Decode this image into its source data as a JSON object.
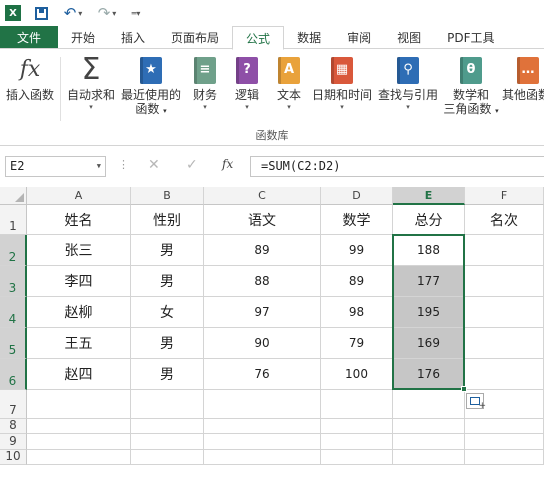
{
  "quick_access": {
    "app_icon": "excel-logo",
    "app_letter": "X",
    "save_icon": "save-icon",
    "undo_icon": "undo-icon",
    "redo_icon": "redo-icon"
  },
  "tabs": [
    {
      "label": "文件"
    },
    {
      "label": "开始"
    },
    {
      "label": "插入"
    },
    {
      "label": "页面布局"
    },
    {
      "label": "公式",
      "active": true
    },
    {
      "label": "数据"
    },
    {
      "label": "审阅"
    },
    {
      "label": "视图"
    },
    {
      "label": "PDF工具"
    }
  ],
  "ribbon": {
    "insert_function": {
      "label": "插入函数",
      "glyph": "fx"
    },
    "autosum": {
      "label": "自动求和",
      "glyph": "Σ"
    },
    "recent": {
      "label": "最近使用的",
      "label2": "函数"
    },
    "financial": {
      "label": "财务"
    },
    "logical": {
      "label": "逻辑",
      "glyph": "?"
    },
    "text": {
      "label": "文本",
      "glyph": "A"
    },
    "datetime": {
      "label": "日期和时间"
    },
    "lookup": {
      "label": "查找与引用"
    },
    "math": {
      "label": "数学和",
      "label2": "三角函数",
      "glyph": "θ"
    },
    "more": {
      "label": "其他函数"
    },
    "group_label": "函数库",
    "colors": {
      "recent": "#2e6db5",
      "financial": "#6fa08a",
      "logical": "#8e4fa7",
      "text": "#e9a23b",
      "datetime": "#d9583b",
      "lookup": "#2e6db5",
      "math": "#4f9b8c",
      "more": "#e0723a"
    }
  },
  "formula_bar": {
    "name_box": "E2",
    "cancel_icon": "✕",
    "enter_icon": "✓",
    "fx_label": "fx",
    "formula": "=SUM(C2:D2)"
  },
  "columns": [
    "A",
    "B",
    "C",
    "D",
    "E",
    "F"
  ],
  "rows": [
    "1",
    "2",
    "3",
    "4",
    "5",
    "6",
    "7",
    "8",
    "9",
    "10"
  ],
  "table": {
    "header": [
      "姓名",
      "性别",
      "语文",
      "数学",
      "总分",
      "名次"
    ],
    "body": [
      [
        "张三",
        "男",
        "89",
        "99",
        "188",
        ""
      ],
      [
        "李四",
        "男",
        "88",
        "89",
        "177",
        ""
      ],
      [
        "赵柳",
        "女",
        "97",
        "98",
        "195",
        ""
      ],
      [
        "王五",
        "男",
        "90",
        "79",
        "169",
        ""
      ],
      [
        "赵四",
        "男",
        "76",
        "100",
        "176",
        ""
      ]
    ]
  },
  "selection": {
    "active_cell": "E2",
    "range": "E2:E6"
  }
}
